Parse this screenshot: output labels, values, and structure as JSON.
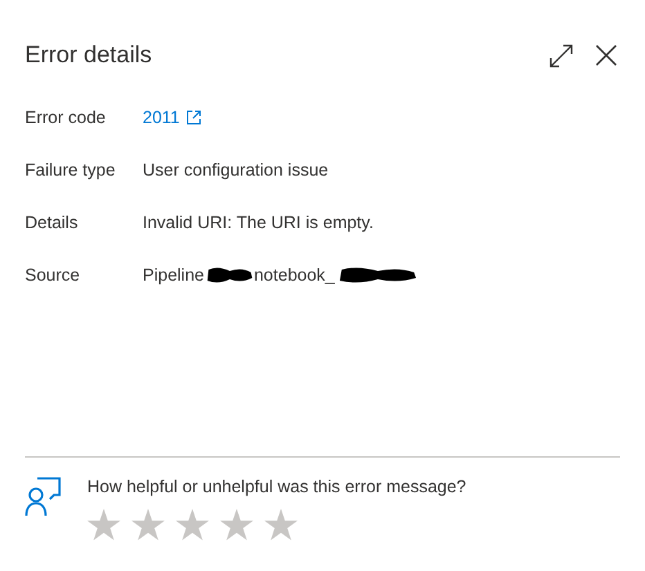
{
  "title": "Error details",
  "fields": [
    {
      "label": "Error code",
      "kind": "link",
      "value": "2011"
    },
    {
      "label": "Failure type",
      "kind": "text",
      "value": "User configuration issue"
    },
    {
      "label": "Details",
      "kind": "text",
      "value": "Invalid URI: The URI is empty."
    },
    {
      "label": "Source",
      "kind": "redacted",
      "segments": [
        "Pipeline",
        "notebook_"
      ]
    }
  ],
  "feedback": {
    "question": "How helpful or unhelpful was this error message?",
    "stars": 0
  }
}
